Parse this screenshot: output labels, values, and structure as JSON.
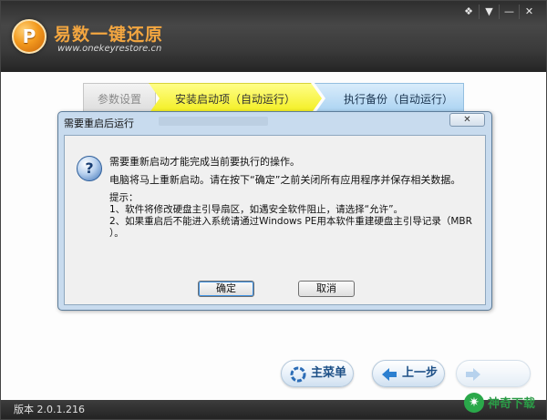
{
  "app": {
    "name": "易数一键还原",
    "url": "www.onekeyrestore.cn",
    "version_label": "版本 2.0.1.216"
  },
  "window_controls": [
    "pin-icon",
    "dropdown-icon",
    "minimize-icon",
    "close-icon"
  ],
  "steps": [
    {
      "label": "参数设置",
      "state": "done"
    },
    {
      "label": "安装启动项（自动运行）",
      "state": "active"
    },
    {
      "label": "执行备份（自动运行）",
      "state": "pending"
    }
  ],
  "dialog": {
    "title": "需要重启后运行",
    "close_label": "✕",
    "message_1": "需要重新启动才能完成当前要执行的操作。",
    "message_2": "电脑将马上重新启动。请在按下“确定”之前关闭所有应用程序并保存相关数据。",
    "tip_title": "提示：",
    "tip_lines": [
      "1、软件将修改硬盘主引导扇区，如遇安全软件阻止，请选择“允许”。",
      "2、如果重启后不能进入系统请通过Windows PE用本软件重建硬盘主引导记录（MBR",
      "）。"
    ],
    "ok_label": "确定",
    "cancel_label": "取消"
  },
  "nav": {
    "main_menu_label": "主菜单",
    "prev_label": "上一步",
    "next_label": ""
  },
  "watermark": {
    "text": "神奇下载"
  },
  "colors": {
    "title_bar": "#3a3a3a",
    "brand_orange": "#f3a640",
    "active_step": "#f3ee1e",
    "pending_step": "#a9d2f1",
    "dialog_frame": "#c8dbee"
  }
}
